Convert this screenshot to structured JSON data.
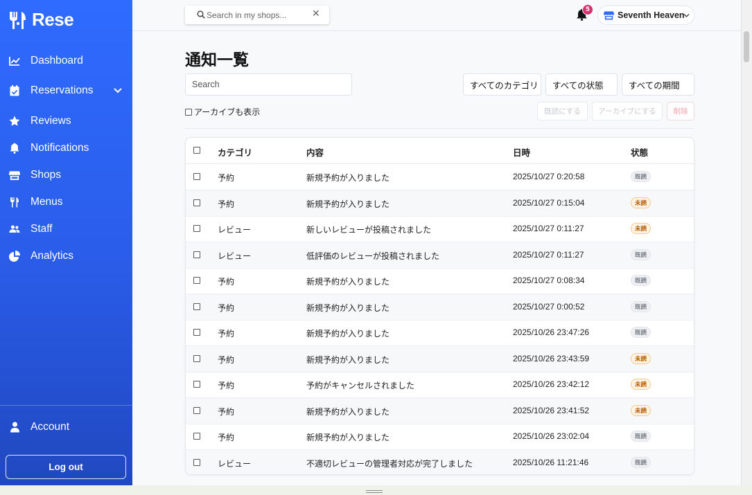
{
  "brand": {
    "name": "Rese"
  },
  "sidebar": {
    "items": [
      {
        "label": "Dashboard",
        "icon": "chart-line-icon"
      },
      {
        "label": "Reservations",
        "icon": "calendar-check-icon",
        "expandable": true
      },
      {
        "label": "Reviews",
        "icon": "star-icon"
      },
      {
        "label": "Notifications",
        "icon": "bell-icon"
      },
      {
        "label": "Shops",
        "icon": "store-icon"
      },
      {
        "label": "Menus",
        "icon": "utensils-icon"
      },
      {
        "label": "Staff",
        "icon": "users-icon"
      },
      {
        "label": "Analytics",
        "icon": "pie-chart-icon"
      }
    ],
    "account_label": "Account",
    "logout_label": "Log out"
  },
  "topbar": {
    "search_placeholder": "Search in my shops...",
    "clear_symbol": "✕",
    "notification_count": "5",
    "shop_name": "Seventh Heaven"
  },
  "page": {
    "title": "通知一覧",
    "search_placeholder": "Search",
    "filters": {
      "category": "すべてのカテゴリ",
      "status": "すべての状態",
      "period": "すべての期間"
    },
    "show_archived_label": "アーカイブも表示",
    "actions": {
      "mark_read": "既読にする",
      "archive": "アーカイブにする",
      "delete": "削除"
    }
  },
  "table": {
    "headers": {
      "category": "カテゴリ",
      "content": "内容",
      "datetime": "日時",
      "status": "状態"
    },
    "rows": [
      {
        "category": "予約",
        "content": "新規予約が入りました",
        "datetime": "2025/10/27 0:20:58",
        "status": "既読",
        "unread": false
      },
      {
        "category": "予約",
        "content": "新規予約が入りました",
        "datetime": "2025/10/27 0:15:04",
        "status": "未読",
        "unread": true
      },
      {
        "category": "レビュー",
        "content": "新しいレビューが投稿されました",
        "datetime": "2025/10/27 0:11:27",
        "status": "未読",
        "unread": true
      },
      {
        "category": "レビュー",
        "content": "低評価のレビューが投稿されました",
        "datetime": "2025/10/27 0:11:27",
        "status": "既読",
        "unread": false
      },
      {
        "category": "予約",
        "content": "新規予約が入りました",
        "datetime": "2025/10/27 0:08:34",
        "status": "既読",
        "unread": false
      },
      {
        "category": "予約",
        "content": "新規予約が入りました",
        "datetime": "2025/10/27 0:00:52",
        "status": "既読",
        "unread": false
      },
      {
        "category": "予約",
        "content": "新規予約が入りました",
        "datetime": "2025/10/26 23:47:26",
        "status": "既読",
        "unread": false
      },
      {
        "category": "予約",
        "content": "新規予約が入りました",
        "datetime": "2025/10/26 23:43:59",
        "status": "未読",
        "unread": true
      },
      {
        "category": "予約",
        "content": "予約がキャンセルされました",
        "datetime": "2025/10/26 23:42:12",
        "status": "未読",
        "unread": true
      },
      {
        "category": "予約",
        "content": "新規予約が入りました",
        "datetime": "2025/10/26 23:41:52",
        "status": "未読",
        "unread": true
      },
      {
        "category": "予約",
        "content": "新規予約が入りました",
        "datetime": "2025/10/26 23:02:04",
        "status": "既読",
        "unread": false
      },
      {
        "category": "レビュー",
        "content": "不適切レビューの管理者対応が完了しました",
        "datetime": "2025/10/26 11:21:46",
        "status": "既読",
        "unread": false
      }
    ]
  },
  "colors": {
    "sidebar_top": "#2f6bff",
    "sidebar_bottom": "#2048bf",
    "badge_pink": "#d6336c",
    "unread_text": "#b35a00"
  }
}
